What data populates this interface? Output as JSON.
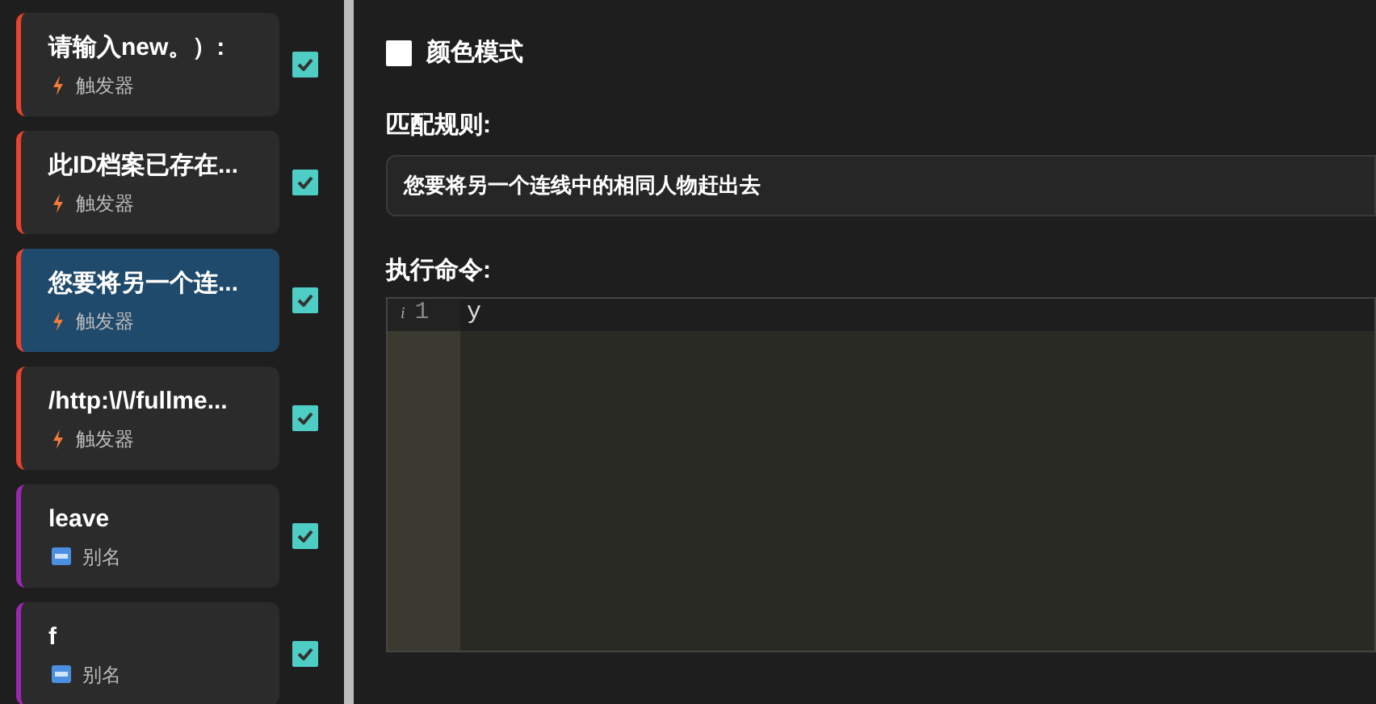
{
  "sidebar": {
    "items": [
      {
        "title": "请输入new。）:",
        "kind": "trigger",
        "type_label": "触发器",
        "selected": false,
        "checked": true
      },
      {
        "title": "此ID档案已存在...",
        "kind": "trigger",
        "type_label": "触发器",
        "selected": false,
        "checked": true
      },
      {
        "title": "您要将另一个连...",
        "kind": "trigger",
        "type_label": "触发器",
        "selected": true,
        "checked": true
      },
      {
        "title": "/http:\\/\\/fullme...",
        "kind": "trigger",
        "type_label": "触发器",
        "selected": false,
        "checked": true
      },
      {
        "title": "leave",
        "kind": "alias",
        "type_label": "别名",
        "selected": false,
        "checked": true
      },
      {
        "title": "f",
        "kind": "alias",
        "type_label": "别名",
        "selected": false,
        "checked": true
      }
    ]
  },
  "color_mode": {
    "label": "颜色模式",
    "checked": false
  },
  "match_rule": {
    "label": "匹配规则:",
    "value": "您要将另一个连线中的相同人物赶出去"
  },
  "command": {
    "label": "执行命令:",
    "lines": [
      {
        "number": "1",
        "marker": "i",
        "text": "y"
      }
    ]
  }
}
